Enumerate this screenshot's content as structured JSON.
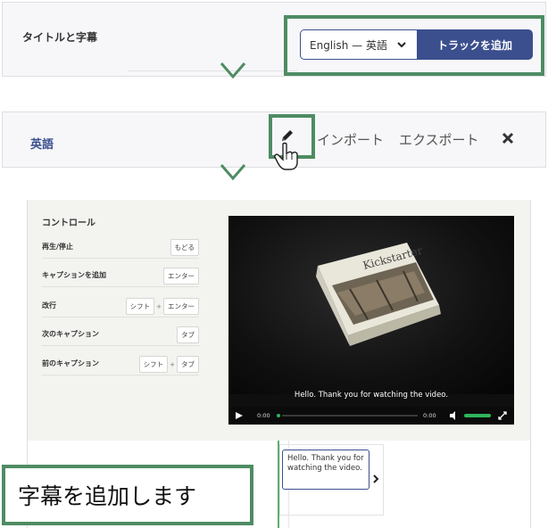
{
  "panel1": {
    "title": "タイトルと字幕",
    "language_select": "English — 英語",
    "add_track_button": "トラックを追加"
  },
  "panel2": {
    "language": "英語",
    "import_link": "インポート",
    "export_link": "エクスポート"
  },
  "panel3": {
    "controls_title": "コントロール",
    "shortcuts": [
      {
        "label": "再生/停止",
        "keys": [
          "もどる"
        ]
      },
      {
        "label": "キャプションを追加",
        "keys": [
          "エンター"
        ]
      },
      {
        "label": "改行",
        "keys": [
          "シフト",
          "エンター"
        ]
      },
      {
        "label": "次のキャプション",
        "keys": [
          "タブ"
        ]
      },
      {
        "label": "前のキャプション",
        "keys": [
          "シフト",
          "タブ"
        ]
      }
    ],
    "video": {
      "book_title": "Kickstarter",
      "caption": "Hello. Thank you for watching the video.",
      "time_current": "0:00",
      "time_total": "0:00"
    },
    "caption_editor_text": "Hello. Thank you for watching the video."
  },
  "callout": "字幕を追加します",
  "colors": {
    "accent": "#3b4f8e",
    "highlight": "#4e8c63",
    "progress": "#2fb55b"
  }
}
